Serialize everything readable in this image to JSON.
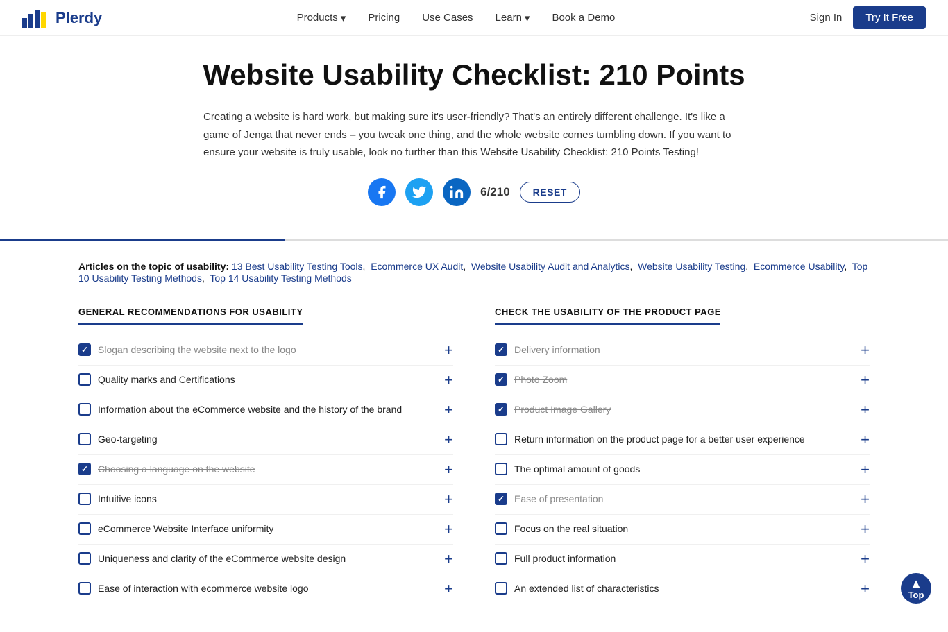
{
  "nav": {
    "logo_text": "Plerdy",
    "links": [
      {
        "label": "Products",
        "has_dropdown": true
      },
      {
        "label": "Pricing",
        "has_dropdown": false
      },
      {
        "label": "Use Cases",
        "has_dropdown": false
      },
      {
        "label": "Learn",
        "has_dropdown": true
      },
      {
        "label": "Book a Demo",
        "has_dropdown": false
      }
    ],
    "sign_in": "Sign In",
    "try_free": "Try It Free"
  },
  "hero": {
    "title": "Website Usability Checklist: 210 Points",
    "description": "Creating a website is hard work, but making sure it's user-friendly? That's an entirely different challenge. It's like a game of Jenga that never ends – you tweak one thing, and the whole website comes tumbling down. If you want to ensure your website is truly usable, look no further than this Website Usability Checklist: 210 Points Testing!",
    "counter": "6/210",
    "reset_label": "RESET"
  },
  "articles": {
    "label": "Articles on the topic of usability:",
    "links": [
      "13 Best Usability Testing Tools",
      "Ecommerce UX Audit",
      "Website Usability Audit and Analytics",
      "Website Usability Testing",
      "Ecommerce Usability",
      "Top 10 Usability Testing Methods",
      "Top 14 Usability Testing Methods"
    ]
  },
  "left_checklist": {
    "title": "GENERAL RECOMMENDATIONS FOR USABILITY",
    "items": [
      {
        "text": "Slogan describing the website next to the logo",
        "checked": true,
        "strikethrough": true
      },
      {
        "text": "Quality marks and Certifications",
        "checked": false,
        "strikethrough": false
      },
      {
        "text": "Information about the eCommerce website and the history of the brand",
        "checked": false,
        "strikethrough": false
      },
      {
        "text": "Geo-targeting",
        "checked": false,
        "strikethrough": false
      },
      {
        "text": "Choosing a language on the website",
        "checked": true,
        "strikethrough": true
      },
      {
        "text": "Intuitive icons",
        "checked": false,
        "strikethrough": false
      },
      {
        "text": "eCommerce Website Interface uniformity",
        "checked": false,
        "strikethrough": false
      },
      {
        "text": "Uniqueness and clarity of the eCommerce website design",
        "checked": false,
        "strikethrough": false
      },
      {
        "text": "Ease of interaction with ecommerce website logo",
        "checked": false,
        "strikethrough": false
      }
    ]
  },
  "right_checklist": {
    "title": "CHECK THE USABILITY OF THE PRODUCT PAGE",
    "items": [
      {
        "text": "Delivery information",
        "checked": true,
        "strikethrough": true
      },
      {
        "text": "Photo Zoom",
        "checked": true,
        "strikethrough": true
      },
      {
        "text": "Product Image Gallery",
        "checked": true,
        "strikethrough": true
      },
      {
        "text": "Return information on the product page for a better user experience",
        "checked": false,
        "strikethrough": false
      },
      {
        "text": "The optimal amount of goods",
        "checked": false,
        "strikethrough": false
      },
      {
        "text": "Ease of presentation",
        "checked": true,
        "strikethrough": true
      },
      {
        "text": "Focus on the real situation",
        "checked": false,
        "strikethrough": false
      },
      {
        "text": "Full product information",
        "checked": false,
        "strikethrough": false
      },
      {
        "text": "An extended list of characteristics",
        "checked": false,
        "strikethrough": false
      }
    ]
  },
  "scroll_top": "Top"
}
